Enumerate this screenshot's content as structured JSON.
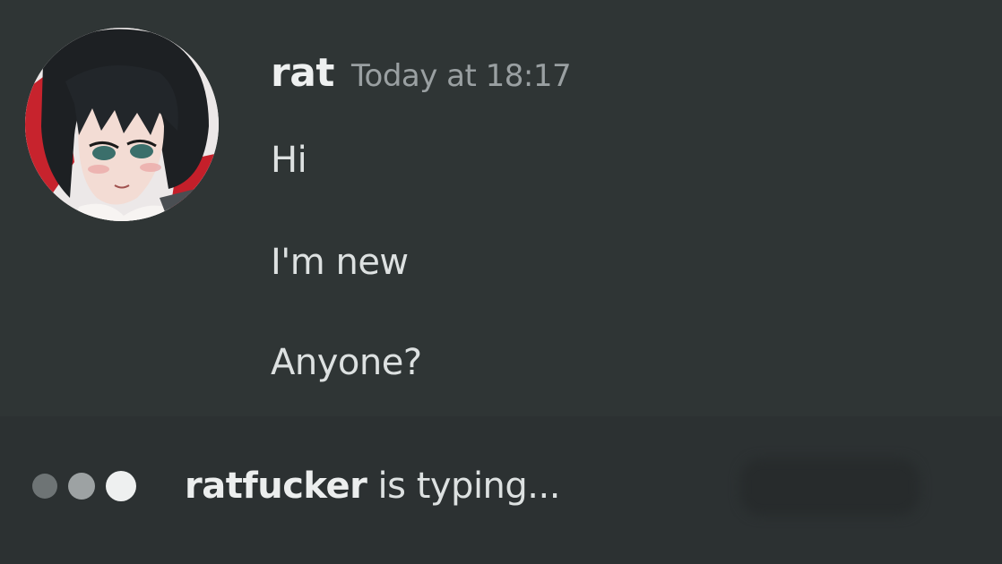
{
  "message": {
    "author": "rat",
    "timestamp": "Today at 18:17",
    "lines": [
      "Hi",
      "I'm new",
      "Anyone?"
    ]
  },
  "typing": {
    "user": "ratfucker",
    "suffix": "is typing..."
  },
  "colors": {
    "background": "#2f3535",
    "username": "#eef0f0",
    "timestamp": "#9aa0a2",
    "message_text": "#dde1e1"
  }
}
